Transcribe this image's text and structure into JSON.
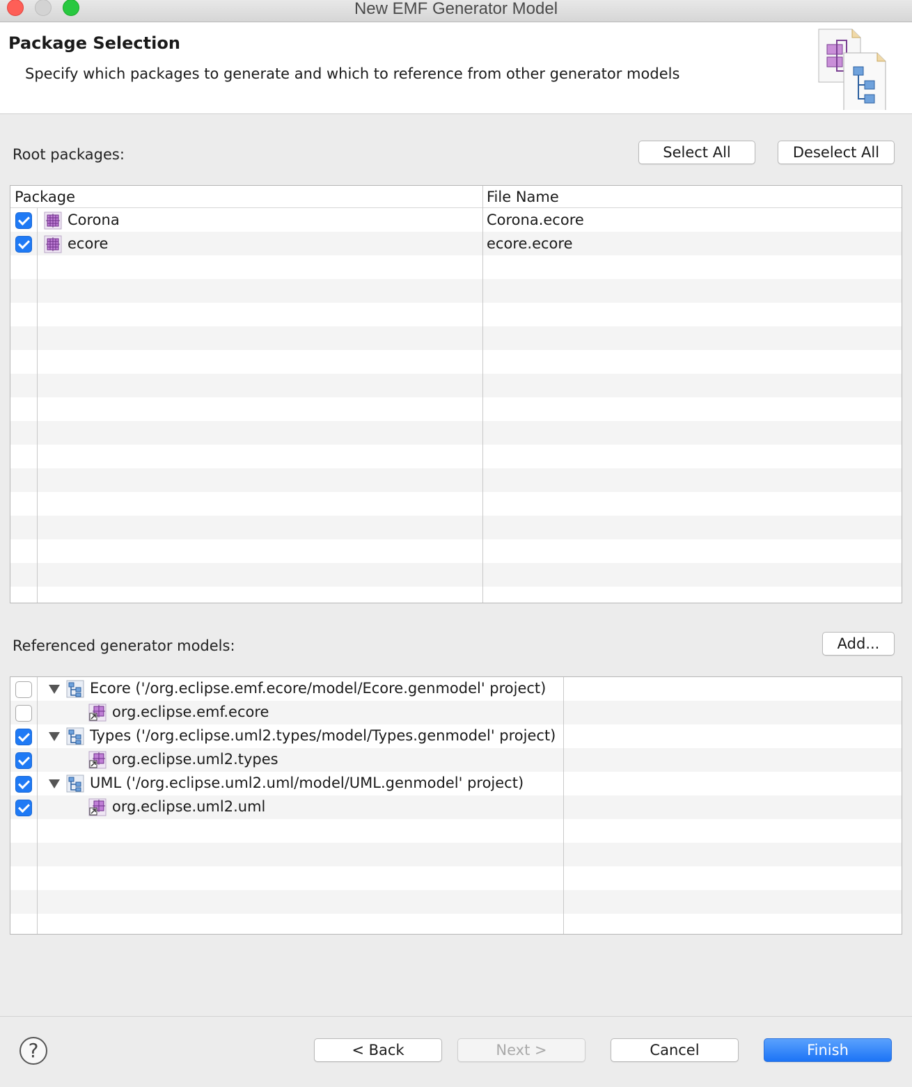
{
  "window": {
    "title": "New EMF Generator Model"
  },
  "header": {
    "title": "Package Selection",
    "description": "Specify which packages to generate and which to reference from other generator models",
    "icon": "generator-model-wizard-icon"
  },
  "root_packages": {
    "label": "Root packages:",
    "select_all": "Select All",
    "deselect_all": "Deselect All",
    "columns": [
      "Package",
      "File Name"
    ],
    "rows": [
      {
        "checked": true,
        "icon": "package-icon",
        "name": "Corona",
        "file": "Corona.ecore"
      },
      {
        "checked": true,
        "icon": "package-icon",
        "name": "ecore",
        "file": "ecore.ecore"
      }
    ]
  },
  "referenced": {
    "label": "Referenced generator models:",
    "add": "Add...",
    "rows": [
      {
        "checked": false,
        "expanded": true,
        "level": 0,
        "icon": "genmodel-icon",
        "text": "Ecore ('/org.eclipse.emf.ecore/model/Ecore.genmodel' project)"
      },
      {
        "checked": false,
        "level": 1,
        "icon": "genpackage-icon",
        "text": "org.eclipse.emf.ecore"
      },
      {
        "checked": true,
        "expanded": true,
        "level": 0,
        "icon": "genmodel-icon",
        "text": "Types ('/org.eclipse.uml2.types/model/Types.genmodel' project)"
      },
      {
        "checked": true,
        "level": 1,
        "icon": "genpackage-icon",
        "text": "org.eclipse.uml2.types"
      },
      {
        "checked": true,
        "expanded": true,
        "level": 0,
        "icon": "genmodel-icon",
        "text": "UML ('/org.eclipse.uml2.uml/model/UML.genmodel' project)"
      },
      {
        "checked": true,
        "level": 1,
        "icon": "genpackage-icon",
        "text": "org.eclipse.uml2.uml"
      }
    ]
  },
  "footer": {
    "help": "?",
    "back": "< Back",
    "next": "Next >",
    "cancel": "Cancel",
    "finish": "Finish"
  },
  "colors": {
    "accent": "#1f7af5",
    "package_icon": "#8a4fbf"
  }
}
